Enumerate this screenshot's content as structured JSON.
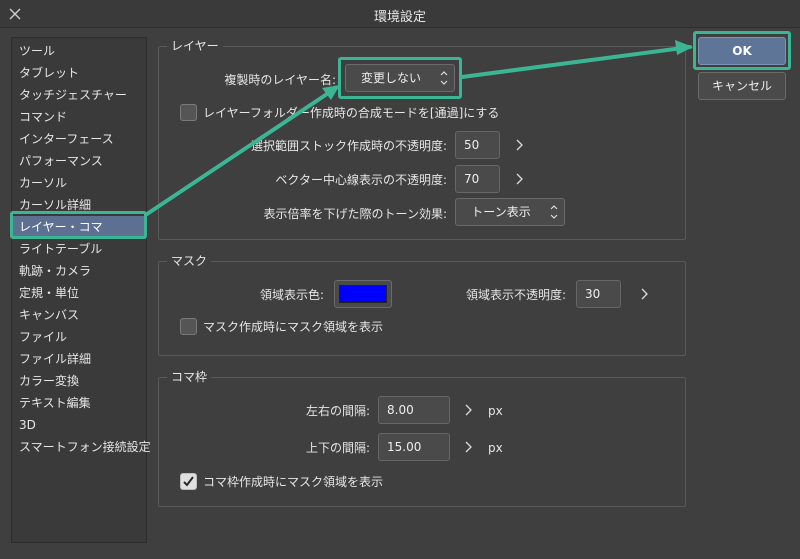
{
  "window": {
    "title": "環境設定"
  },
  "sidebar": {
    "items": [
      {
        "label": "ツール"
      },
      {
        "label": "タブレット"
      },
      {
        "label": "タッチジェスチャー"
      },
      {
        "label": "コマンド"
      },
      {
        "label": "インターフェース"
      },
      {
        "label": "パフォーマンス"
      },
      {
        "label": "カーソル"
      },
      {
        "label": "カーソル詳細"
      },
      {
        "label": "レイヤー・コマ"
      },
      {
        "label": "ライトテーブル"
      },
      {
        "label": "軌跡・カメラ"
      },
      {
        "label": "定規・単位"
      },
      {
        "label": "キャンバス"
      },
      {
        "label": "ファイル"
      },
      {
        "label": "ファイル詳細"
      },
      {
        "label": "カラー変換"
      },
      {
        "label": "テキスト編集"
      },
      {
        "label": "3D"
      },
      {
        "label": "スマートフォン接続設定"
      }
    ],
    "selected_index": 8
  },
  "layer_group": {
    "title": "レイヤー",
    "dup_name_label": "複製時のレイヤー名:",
    "dup_name_value": "変更しない",
    "folder_blend_label": "レイヤーフォルダー作成時の合成モードを[通過]にする",
    "folder_blend_checked": false,
    "selection_opacity_label": "選択範囲ストック作成時の不透明度:",
    "selection_opacity_value": "50",
    "vector_opacity_label": "ベクター中心線表示の不透明度:",
    "vector_opacity_value": "70",
    "tone_effect_label": "表示倍率を下げた際のトーン効果:",
    "tone_effect_value": "トーン表示"
  },
  "mask_group": {
    "title": "マスク",
    "color_label": "領域表示色:",
    "color_value": "#0000ff",
    "opacity_label": "領域表示不透明度:",
    "opacity_value": "30",
    "show_on_create_label": "マスク作成時にマスク領域を表示",
    "show_on_create_checked": false
  },
  "frame_group": {
    "title": "コマ枠",
    "horizontal_gap_label": "左右の間隔:",
    "horizontal_gap_value": "8.00",
    "vertical_gap_label": "上下の間隔:",
    "vertical_gap_value": "15.00",
    "unit": "px",
    "show_mask_label": "コマ枠作成時にマスク領域を表示",
    "show_mask_checked": true
  },
  "buttons": {
    "ok": "OK",
    "cancel": "キャンセル"
  },
  "colors": {
    "highlight": "#3bb694",
    "selected": "#5d7091",
    "ok": "#5f7598"
  }
}
